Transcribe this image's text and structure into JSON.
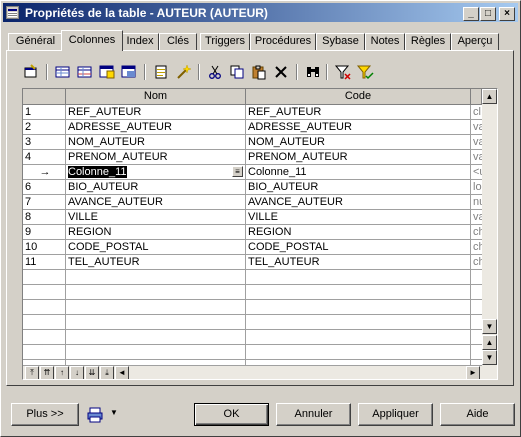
{
  "window": {
    "title": "Propriétés de la table - AUTEUR (AUTEUR)",
    "controls": {
      "minimize": "_",
      "maximize": "□",
      "close": "×"
    }
  },
  "tabs": [
    {
      "label": "Général",
      "active": false
    },
    {
      "label": "Colonnes",
      "active": true
    },
    {
      "label": "Index",
      "active": false
    },
    {
      "label": "Clés",
      "active": false
    },
    {
      "label": "Triggers",
      "active": false
    },
    {
      "label": "Procédures",
      "active": false
    },
    {
      "label": "Sybase",
      "active": false
    },
    {
      "label": "Notes",
      "active": false
    },
    {
      "label": "Règles",
      "active": false
    },
    {
      "label": "Aperçu",
      "active": false
    }
  ],
  "toolbar": {
    "icons": [
      "properties-icon",
      "add-row-icon",
      "insert-row-icon",
      "add-columns-icon",
      "add-attributes-icon",
      "edit-icon",
      "wand-icon",
      "cut-icon",
      "copy-icon",
      "paste-icon",
      "delete-icon",
      "find-icon",
      "filter-icon",
      "customize-columns-icon"
    ]
  },
  "grid": {
    "columns": [
      "Nom",
      "Code"
    ],
    "rows": [
      {
        "num": "1",
        "nom": "REF_AUTEUR",
        "code": "REF_AUTEUR",
        "extra": "cl"
      },
      {
        "num": "2",
        "nom": "ADRESSE_AUTEUR",
        "code": "ADRESSE_AUTEUR",
        "extra": "va"
      },
      {
        "num": "3",
        "nom": "NOM_AUTEUR",
        "code": "NOM_AUTEUR",
        "extra": "va"
      },
      {
        "num": "4",
        "nom": "PRENOM_AUTEUR",
        "code": "PRENOM_AUTEUR",
        "extra": "va"
      },
      {
        "num": "→",
        "nom": "Colonne_11",
        "code": "Colonne_11",
        "extra": "<u"
      },
      {
        "num": "6",
        "nom": "BIO_AUTEUR",
        "code": "BIO_AUTEUR",
        "extra": "lo"
      },
      {
        "num": "7",
        "nom": "AVANCE_AUTEUR",
        "code": "AVANCE_AUTEUR",
        "extra": "nu"
      },
      {
        "num": "8",
        "nom": "VILLE",
        "code": "VILLE",
        "extra": "va"
      },
      {
        "num": "9",
        "nom": "REGION",
        "code": "REGION",
        "extra": "ch"
      },
      {
        "num": "10",
        "nom": "CODE_POSTAL",
        "code": "CODE_POSTAL",
        "extra": "ch"
      },
      {
        "num": "11",
        "nom": "TEL_AUTEUR",
        "code": "TEL_AUTEUR",
        "extra": "ch"
      }
    ],
    "empty_rows": 7,
    "editing_button": "≡"
  },
  "footer": {
    "more_label": "Plus >>",
    "print_icon": "printer-icon",
    "dropdown_arrow": "▼",
    "ok_label": "OK",
    "cancel_label": "Annuler",
    "apply_label": "Appliquer",
    "help_label": "Aide"
  },
  "colors": {
    "titlebar_start": "#0a246a",
    "titlebar_end": "#a6caf0",
    "face": "#d4d0c8",
    "selection": "#000000"
  }
}
